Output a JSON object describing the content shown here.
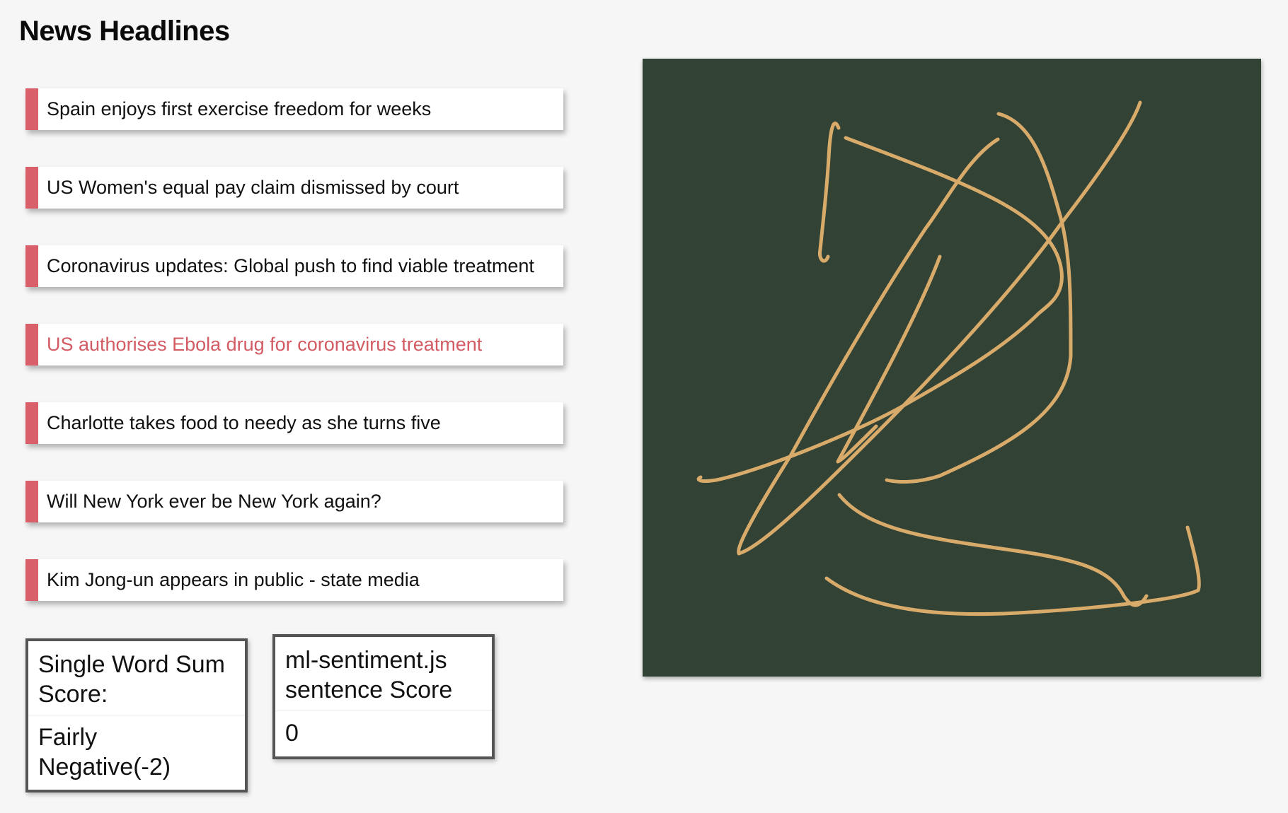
{
  "page": {
    "title": "News Headlines"
  },
  "headlines": [
    {
      "text": "Spain enjoys first exercise freedom for weeks",
      "active": false
    },
    {
      "text": "US Women's equal pay claim dismissed by court",
      "active": false
    },
    {
      "text": "Coronavirus updates: Global push to find viable treatment",
      "active": false
    },
    {
      "text": "US authorises Ebola drug for coronavirus treatment",
      "active": true
    },
    {
      "text": "Charlotte takes food to needy as she turns five",
      "active": false
    },
    {
      "text": "Will New York ever be New York again?",
      "active": false
    },
    {
      "text": "Kim Jong-un appears in public - state media",
      "active": false
    }
  ],
  "scores": {
    "single_word": {
      "label": "Single Word Sum Score:",
      "value": "Fairly Negative(-2)"
    },
    "ml_sentiment": {
      "label": "ml-sentiment.js sentence Score",
      "value": "0"
    }
  },
  "drawing_canvas": {
    "background": "#324235",
    "stroke_color": "#d9ab6a"
  },
  "colors": {
    "accent": "#d9606a",
    "active_text": "#d35b63",
    "page_background": "#f6f6f6"
  }
}
